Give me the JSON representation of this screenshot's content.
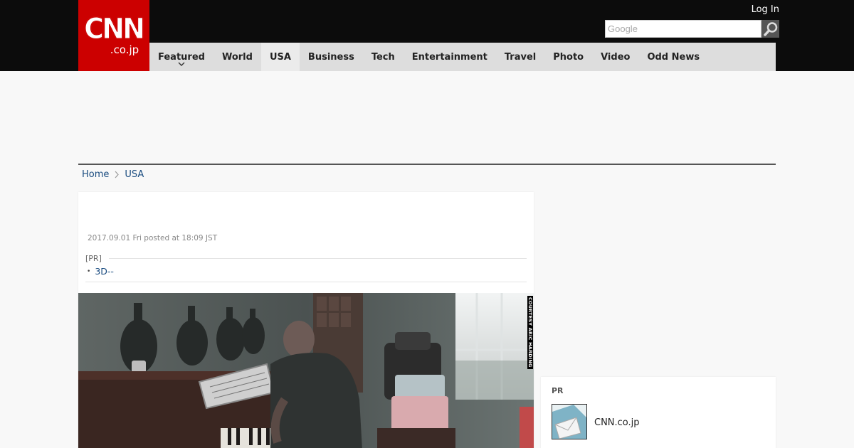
{
  "header": {
    "logo_main": "CNN",
    "logo_sub": ".co.jp",
    "login_label": "Log In",
    "search_placeholder": "Google"
  },
  "nav": {
    "items": [
      {
        "label": "Featured"
      },
      {
        "label": "World"
      },
      {
        "label": "USA"
      },
      {
        "label": "Business"
      },
      {
        "label": "Tech"
      },
      {
        "label": "Entertainment"
      },
      {
        "label": "Travel"
      },
      {
        "label": "Photo"
      },
      {
        "label": "Video"
      },
      {
        "label": "Odd News"
      }
    ],
    "active": "USA"
  },
  "breadcrumb": {
    "home": "Home",
    "section": "USA"
  },
  "article": {
    "posted": "2017.09.01 Fri posted at 18:09 JST",
    "pr_tag": "[PR]",
    "pr_link": "3D--",
    "photo_credit": "COURTESY ARIC HARDING"
  },
  "sidebar": {
    "pr_label": "PR",
    "pr_item_title": "CNN.co.jp"
  },
  "colors": {
    "brand_red": "#cc0000",
    "header_bg": "#0c0c0c",
    "nav_bg": "#dddddd",
    "link": "#1a4c80"
  }
}
